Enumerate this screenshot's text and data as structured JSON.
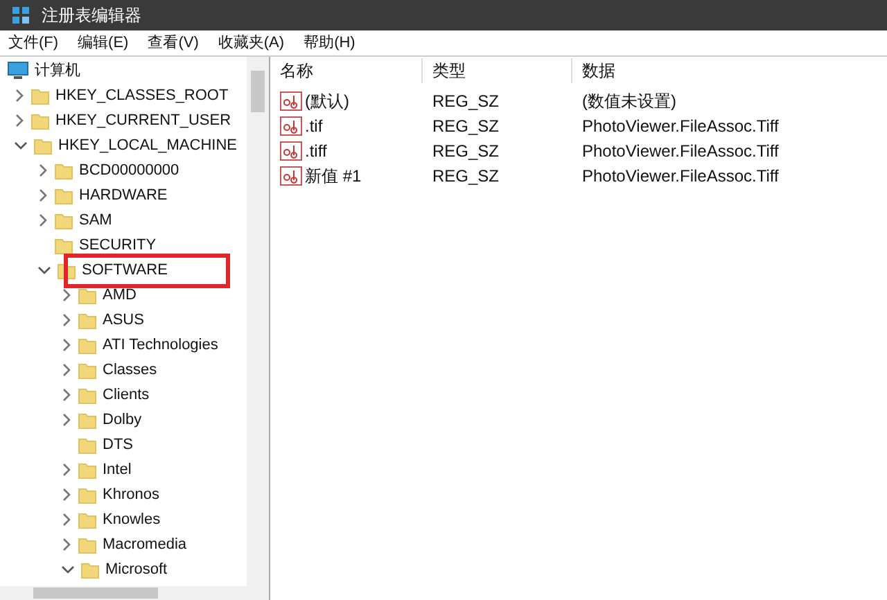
{
  "window": {
    "title": "注册表编辑器"
  },
  "menu": [
    "文件(F)",
    "编辑(E)",
    "查看(V)",
    "收藏夹(A)",
    "帮助(H)"
  ],
  "tree": {
    "root": "计算机",
    "children": [
      {
        "label": "HKEY_CLASSES_ROOT",
        "expanded": false,
        "leaf": false,
        "boxed": false
      },
      {
        "label": "HKEY_CURRENT_USER",
        "expanded": false,
        "leaf": false,
        "boxed": false
      },
      {
        "label": "HKEY_LOCAL_MACHINE",
        "expanded": true,
        "leaf": false,
        "boxed": false,
        "children": [
          {
            "label": "BCD00000000",
            "expanded": false,
            "leaf": false,
            "boxed": false
          },
          {
            "label": "HARDWARE",
            "expanded": false,
            "leaf": false,
            "boxed": false
          },
          {
            "label": "SAM",
            "expanded": false,
            "leaf": false,
            "boxed": false
          },
          {
            "label": "SECURITY",
            "expanded": false,
            "leaf": true,
            "boxed": false
          },
          {
            "label": "SOFTWARE",
            "expanded": true,
            "leaf": false,
            "boxed": true,
            "children": [
              {
                "label": "AMD",
                "expanded": false,
                "leaf": false,
                "boxed": false
              },
              {
                "label": "ASUS",
                "expanded": false,
                "leaf": false,
                "boxed": false
              },
              {
                "label": "ATI Technologies",
                "expanded": false,
                "leaf": false,
                "boxed": false
              },
              {
                "label": "Classes",
                "expanded": false,
                "leaf": false,
                "boxed": false
              },
              {
                "label": "Clients",
                "expanded": false,
                "leaf": false,
                "boxed": false
              },
              {
                "label": "Dolby",
                "expanded": false,
                "leaf": false,
                "boxed": false
              },
              {
                "label": "DTS",
                "expanded": false,
                "leaf": true,
                "boxed": false
              },
              {
                "label": "Intel",
                "expanded": false,
                "leaf": false,
                "boxed": false
              },
              {
                "label": "Khronos",
                "expanded": false,
                "leaf": false,
                "boxed": false
              },
              {
                "label": "Knowles",
                "expanded": false,
                "leaf": false,
                "boxed": false
              },
              {
                "label": "Macromedia",
                "expanded": false,
                "leaf": false,
                "boxed": false
              },
              {
                "label": "Microsoft",
                "expanded": true,
                "leaf": false,
                "boxed": false
              }
            ]
          }
        ]
      }
    ]
  },
  "table": {
    "columns": [
      "名称",
      "类型",
      "数据"
    ],
    "rows": [
      {
        "name": "(默认)",
        "type": "REG_SZ",
        "data": "(数值未设置)"
      },
      {
        "name": ".tif",
        "type": "REG_SZ",
        "data": "PhotoViewer.FileAssoc.Tiff"
      },
      {
        "name": ".tiff",
        "type": "REG_SZ",
        "data": "PhotoViewer.FileAssoc.Tiff"
      },
      {
        "name": "新值 #1",
        "type": "REG_SZ",
        "data": "PhotoViewer.FileAssoc.Tiff"
      }
    ]
  }
}
